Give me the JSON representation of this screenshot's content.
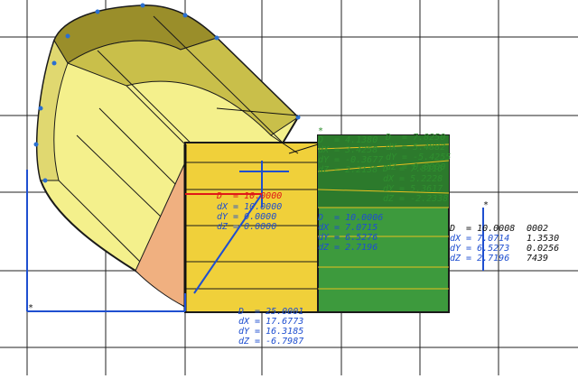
{
  "viewport": {
    "background": "#ffffff",
    "grid_color": "#202020",
    "colors": {
      "cylinder_light": "#f4f08c",
      "cylinder_mid": "#d8d060",
      "cylinder_dark": "#9a8e2a",
      "box_yellow": "#f0d03a",
      "box_green": "#3d9a3d",
      "box_green_dark": "#2c7a2c",
      "orange_face": "#f0b080",
      "dimension_blue": "#1f4fd0",
      "dimension_green": "#2f8f2f",
      "dimension_red": "#e01818"
    }
  },
  "markers": {
    "left_star": "*",
    "top_star": "*",
    "right_star": "*"
  },
  "readouts": {
    "center_block": {
      "d": "D  = 10.0006",
      "dx": "dX = 7.0715",
      "dy": "dY = 6.5276",
      "dz": "dZ = 2.7196"
    },
    "left_block": {
      "d": "D  = 10.0000",
      "dx": "dX = 10.0000",
      "dy": "dY = 0.0000",
      "dz": "dZ = 0.0000"
    },
    "bottom_block": {
      "d": "D  = 25.0001",
      "dx": "dX = 17.6773",
      "dy": "dY = 16.3185",
      "dz": "dZ = -6.7987"
    },
    "top_green_block_a": {
      "d": "D  = 4.1380",
      "dx": "dX = 3.4258",
      "dy": "dY = -0.3677",
      "dz": "dZ = 2.2138"
    },
    "top_green_block_b": {
      "d": "D  = 7.8250",
      "dx": "dX = 5.4882",
      "dy": "dY = -5.4255",
      "dz": "dZ = 0.0000"
    },
    "mid_green_block": {
      "d": "D  = 7.8116",
      "dx": "dX = 5.2228",
      "dy": "dY = 5.3617",
      "dz": "dZ = -2.2338"
    },
    "right_block_a": {
      "d": "D  = 10.0008",
      "dx": "dX = 7.0714",
      "dy": "dY = 6.5273",
      "dz": "dZ = 2.7196"
    },
    "right_block_b": {
      "d": "0002",
      "dx": "1.3530",
      "dy": "0.0256",
      "dz": "7439"
    }
  }
}
